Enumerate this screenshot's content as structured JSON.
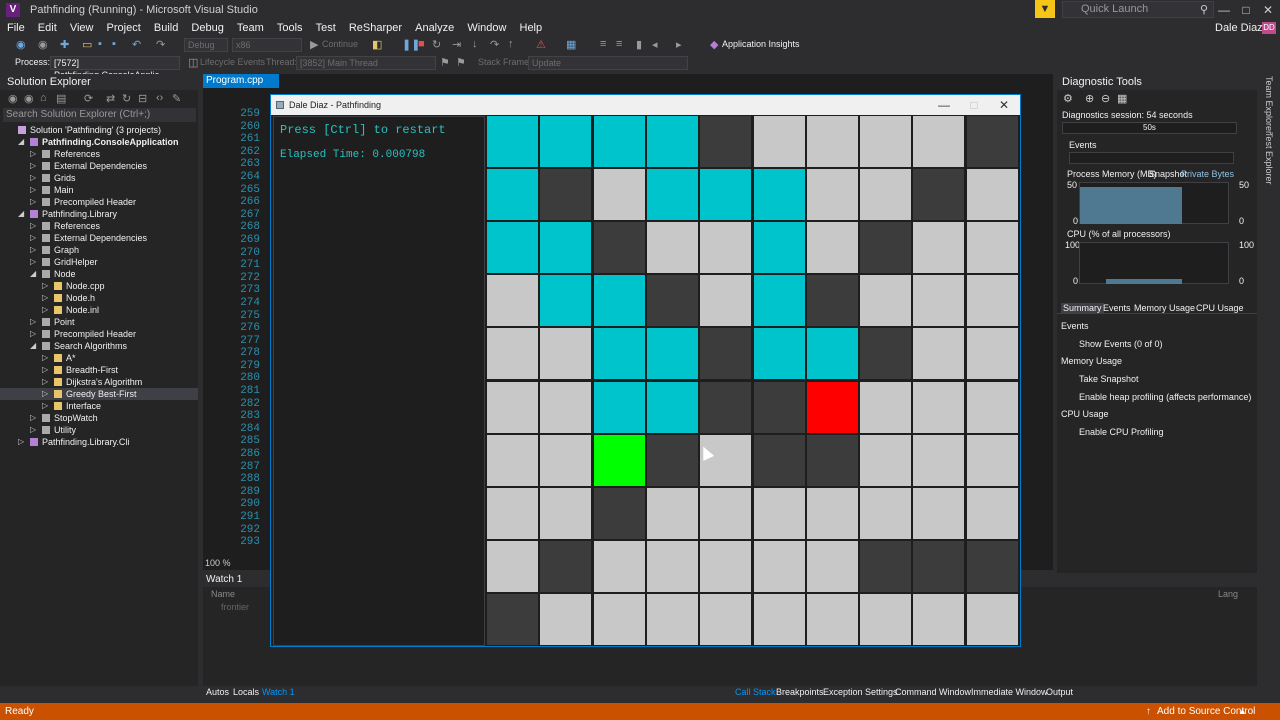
{
  "window": {
    "title": "Pathfinding (Running) - Microsoft Visual Studio",
    "logo_text": "V",
    "quick_launch_placeholder": "Quick Launch",
    "user_name": "Dale Diaz",
    "user_initials": "DD",
    "minimize": "—",
    "maximize": "□",
    "close": "✕"
  },
  "menu": [
    "File",
    "Edit",
    "View",
    "Project",
    "Build",
    "Debug",
    "Team",
    "Tools",
    "Test",
    "ReSharper",
    "Analyze",
    "Window",
    "Help"
  ],
  "toolbar": {
    "config": "Debug",
    "platform": "x86",
    "continue_label": "Continue",
    "app_insights": "Application Insights",
    "process_label": "Process:",
    "process_value": "[7572] Pathfinding.ConsoleApplic",
    "lifecycle_label": "Lifecycle Events",
    "thread_label": "Thread:",
    "thread_value": "[3852] Main Thread",
    "stack_label": "Stack Frame:",
    "stack_value": "Update"
  },
  "solution_explorer": {
    "title": "Solution Explorer",
    "search_placeholder": "Search Solution Explorer (Ctrl+;)",
    "items": [
      {
        "label": "Solution 'Pathfinding' (3 projects)",
        "level": 0,
        "arrow": "",
        "bold": false
      },
      {
        "label": "Pathfinding.ConsoleApplication",
        "level": 1,
        "arrow": "◢",
        "bold": true
      },
      {
        "label": "References",
        "level": 2,
        "arrow": "▷",
        "bold": false
      },
      {
        "label": "External Dependencies",
        "level": 2,
        "arrow": "▷",
        "bold": false
      },
      {
        "label": "Grids",
        "level": 2,
        "arrow": "▷",
        "bold": false
      },
      {
        "label": "Main",
        "level": 2,
        "arrow": "▷",
        "bold": false
      },
      {
        "label": "Precompiled Header",
        "level": 2,
        "arrow": "▷",
        "bold": false
      },
      {
        "label": "Pathfinding.Library",
        "level": 1,
        "arrow": "◢",
        "bold": false
      },
      {
        "label": "References",
        "level": 2,
        "arrow": "▷",
        "bold": false
      },
      {
        "label": "External Dependencies",
        "level": 2,
        "arrow": "▷",
        "bold": false
      },
      {
        "label": "Graph",
        "level": 2,
        "arrow": "▷",
        "bold": false
      },
      {
        "label": "GridHelper",
        "level": 2,
        "arrow": "▷",
        "bold": false
      },
      {
        "label": "Node",
        "level": 2,
        "arrow": "◢",
        "bold": false
      },
      {
        "label": "Node.cpp",
        "level": 3,
        "arrow": "▷",
        "bold": false
      },
      {
        "label": "Node.h",
        "level": 3,
        "arrow": "▷",
        "bold": false
      },
      {
        "label": "Node.inl",
        "level": 3,
        "arrow": "▷",
        "bold": false
      },
      {
        "label": "Point",
        "level": 2,
        "arrow": "▷",
        "bold": false
      },
      {
        "label": "Precompiled Header",
        "level": 2,
        "arrow": "▷",
        "bold": false
      },
      {
        "label": "Search Algorithms",
        "level": 2,
        "arrow": "◢",
        "bold": false
      },
      {
        "label": "A*",
        "level": 3,
        "arrow": "▷",
        "bold": false
      },
      {
        "label": "Breadth-First",
        "level": 3,
        "arrow": "▷",
        "bold": false
      },
      {
        "label": "Dijkstra's Algorithm",
        "level": 3,
        "arrow": "▷",
        "bold": false
      },
      {
        "label": "Greedy Best-First",
        "level": 3,
        "arrow": "▷",
        "bold": false
      },
      {
        "label": "Interface",
        "level": 3,
        "arrow": "▷",
        "bold": false
      },
      {
        "label": "StopWatch",
        "level": 2,
        "arrow": "▷",
        "bold": false
      },
      {
        "label": "Utility",
        "level": 2,
        "arrow": "▷",
        "bold": false
      },
      {
        "label": "Pathfinding.Library.Cli",
        "level": 1,
        "arrow": "▷",
        "bold": false
      }
    ],
    "selected_index": 22
  },
  "editor": {
    "tab_label": "Program.cpp",
    "line_numbers": [
      "259",
      "260",
      "261",
      "262",
      "263",
      "264",
      "265",
      "266",
      "267",
      "268",
      "269",
      "270",
      "271",
      "272",
      "273",
      "274",
      "275",
      "276",
      "277",
      "278",
      "279",
      "280",
      "281",
      "282",
      "283",
      "284",
      "285",
      "286",
      "287",
      "288",
      "289",
      "290",
      "291",
      "292",
      "293"
    ],
    "zoom": "100 %"
  },
  "pathfinding": {
    "title": "Dale Diaz - Pathfinding",
    "restart_text": "Press [Ctrl] to restart",
    "elapsed_text": "Elapsed Time: 0.000798",
    "colors": {
      "c": "#00c4cc",
      "w": "#3c3c3c",
      "e": "#c8c8c8",
      "g": "#00ff00",
      "r": "#ff0000"
    },
    "grid": [
      "ccccweeeew",
      "cweccceewe",
      "ccweecewee",
      "eccwecweee",
      "eeccwccwee",
      "eeccwwreee",
      "eegwewweee",
      "eeweeeeeee",
      "eweeeeewww",
      "weeeeeeeee"
    ]
  },
  "diagnostics": {
    "title": "Diagnostic Tools",
    "session": "Diagnostics session: 54 seconds",
    "timeline_label": "50s",
    "events_label": "Events",
    "memory_label": "Process Memory (MB)",
    "snapshot_label": "Snapshot",
    "private_bytes": "Private Bytes",
    "mem_max_left": "50",
    "mem_min_left": "0",
    "mem_max_right": "50",
    "mem_min_right": "0",
    "cpu_label": "CPU (% of all processors)",
    "cpu_max_left": "100",
    "cpu_min_left": "0",
    "cpu_max_right": "100",
    "cpu_min_right": "0",
    "tabs": [
      "Summary",
      "Events",
      "Memory Usage",
      "CPU Usage"
    ],
    "section_events": "Events",
    "show_events": "Show Events (0 of 0)",
    "section_memory": "Memory Usage",
    "take_snapshot": "Take Snapshot",
    "heap_profiling": "Enable heap profiling (affects performance)",
    "section_cpu": "CPU Usage",
    "cpu_profiling": "Enable CPU Profiling"
  },
  "right_rail": [
    "Team Explorer",
    "Test Explorer"
  ],
  "watch": {
    "title": "Watch 1",
    "column_name": "Name",
    "item_name": "frontier",
    "column_lang": "Lang"
  },
  "bottom_tabs_left": [
    "Autos",
    "Locals",
    "Watch 1"
  ],
  "bottom_tabs_right": [
    "Call Stack",
    "Breakpoints",
    "Exception Settings",
    "Command Window",
    "Immediate Window",
    "Output"
  ],
  "status": {
    "text": "Ready",
    "source_control": "Add to Source Control"
  }
}
